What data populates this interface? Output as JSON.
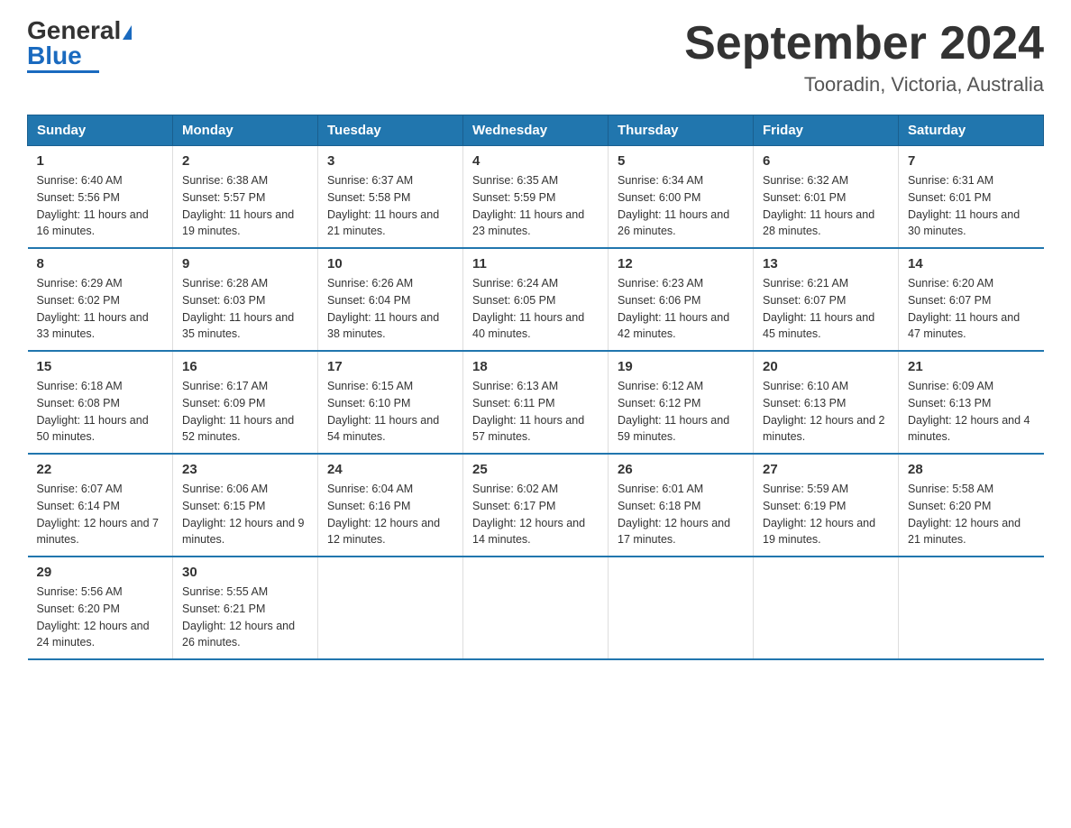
{
  "header": {
    "logo_general": "General",
    "logo_blue": "Blue",
    "month_title": "September 2024",
    "location": "Tooradin, Victoria, Australia"
  },
  "days_of_week": [
    "Sunday",
    "Monday",
    "Tuesday",
    "Wednesday",
    "Thursday",
    "Friday",
    "Saturday"
  ],
  "weeks": [
    [
      {
        "day": "1",
        "sunrise": "6:40 AM",
        "sunset": "5:56 PM",
        "daylight": "11 hours and 16 minutes."
      },
      {
        "day": "2",
        "sunrise": "6:38 AM",
        "sunset": "5:57 PM",
        "daylight": "11 hours and 19 minutes."
      },
      {
        "day": "3",
        "sunrise": "6:37 AM",
        "sunset": "5:58 PM",
        "daylight": "11 hours and 21 minutes."
      },
      {
        "day": "4",
        "sunrise": "6:35 AM",
        "sunset": "5:59 PM",
        "daylight": "11 hours and 23 minutes."
      },
      {
        "day": "5",
        "sunrise": "6:34 AM",
        "sunset": "6:00 PM",
        "daylight": "11 hours and 26 minutes."
      },
      {
        "day": "6",
        "sunrise": "6:32 AM",
        "sunset": "6:01 PM",
        "daylight": "11 hours and 28 minutes."
      },
      {
        "day": "7",
        "sunrise": "6:31 AM",
        "sunset": "6:01 PM",
        "daylight": "11 hours and 30 minutes."
      }
    ],
    [
      {
        "day": "8",
        "sunrise": "6:29 AM",
        "sunset": "6:02 PM",
        "daylight": "11 hours and 33 minutes."
      },
      {
        "day": "9",
        "sunrise": "6:28 AM",
        "sunset": "6:03 PM",
        "daylight": "11 hours and 35 minutes."
      },
      {
        "day": "10",
        "sunrise": "6:26 AM",
        "sunset": "6:04 PM",
        "daylight": "11 hours and 38 minutes."
      },
      {
        "day": "11",
        "sunrise": "6:24 AM",
        "sunset": "6:05 PM",
        "daylight": "11 hours and 40 minutes."
      },
      {
        "day": "12",
        "sunrise": "6:23 AM",
        "sunset": "6:06 PM",
        "daylight": "11 hours and 42 minutes."
      },
      {
        "day": "13",
        "sunrise": "6:21 AM",
        "sunset": "6:07 PM",
        "daylight": "11 hours and 45 minutes."
      },
      {
        "day": "14",
        "sunrise": "6:20 AM",
        "sunset": "6:07 PM",
        "daylight": "11 hours and 47 minutes."
      }
    ],
    [
      {
        "day": "15",
        "sunrise": "6:18 AM",
        "sunset": "6:08 PM",
        "daylight": "11 hours and 50 minutes."
      },
      {
        "day": "16",
        "sunrise": "6:17 AM",
        "sunset": "6:09 PM",
        "daylight": "11 hours and 52 minutes."
      },
      {
        "day": "17",
        "sunrise": "6:15 AM",
        "sunset": "6:10 PM",
        "daylight": "11 hours and 54 minutes."
      },
      {
        "day": "18",
        "sunrise": "6:13 AM",
        "sunset": "6:11 PM",
        "daylight": "11 hours and 57 minutes."
      },
      {
        "day": "19",
        "sunrise": "6:12 AM",
        "sunset": "6:12 PM",
        "daylight": "11 hours and 59 minutes."
      },
      {
        "day": "20",
        "sunrise": "6:10 AM",
        "sunset": "6:13 PM",
        "daylight": "12 hours and 2 minutes."
      },
      {
        "day": "21",
        "sunrise": "6:09 AM",
        "sunset": "6:13 PM",
        "daylight": "12 hours and 4 minutes."
      }
    ],
    [
      {
        "day": "22",
        "sunrise": "6:07 AM",
        "sunset": "6:14 PM",
        "daylight": "12 hours and 7 minutes."
      },
      {
        "day": "23",
        "sunrise": "6:06 AM",
        "sunset": "6:15 PM",
        "daylight": "12 hours and 9 minutes."
      },
      {
        "day": "24",
        "sunrise": "6:04 AM",
        "sunset": "6:16 PM",
        "daylight": "12 hours and 12 minutes."
      },
      {
        "day": "25",
        "sunrise": "6:02 AM",
        "sunset": "6:17 PM",
        "daylight": "12 hours and 14 minutes."
      },
      {
        "day": "26",
        "sunrise": "6:01 AM",
        "sunset": "6:18 PM",
        "daylight": "12 hours and 17 minutes."
      },
      {
        "day": "27",
        "sunrise": "5:59 AM",
        "sunset": "6:19 PM",
        "daylight": "12 hours and 19 minutes."
      },
      {
        "day": "28",
        "sunrise": "5:58 AM",
        "sunset": "6:20 PM",
        "daylight": "12 hours and 21 minutes."
      }
    ],
    [
      {
        "day": "29",
        "sunrise": "5:56 AM",
        "sunset": "6:20 PM",
        "daylight": "12 hours and 24 minutes."
      },
      {
        "day": "30",
        "sunrise": "5:55 AM",
        "sunset": "6:21 PM",
        "daylight": "12 hours and 26 minutes."
      },
      null,
      null,
      null,
      null,
      null
    ]
  ]
}
